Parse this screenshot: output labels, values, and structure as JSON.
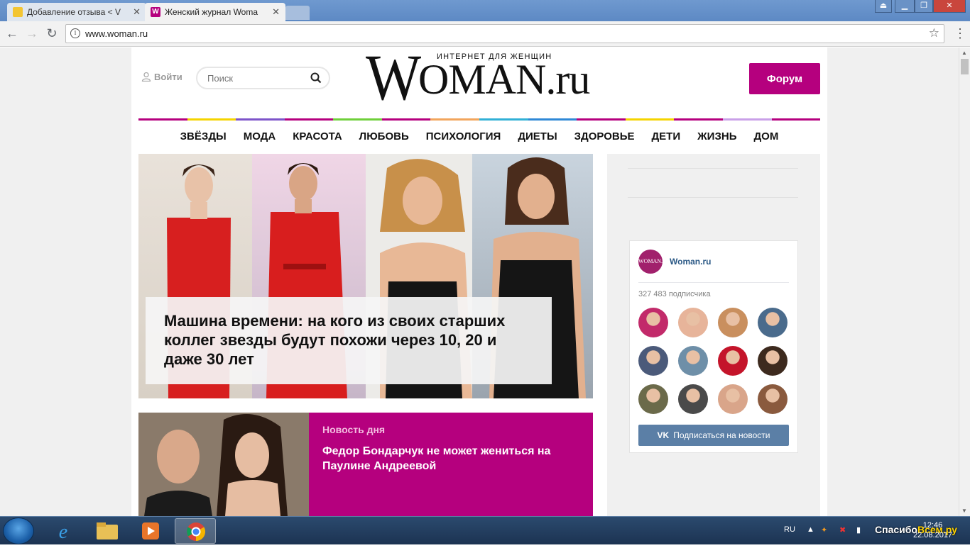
{
  "browser": {
    "tabs": [
      {
        "title": "Добавление отзыва < V",
        "active": false
      },
      {
        "title": "Женский журнал Woma",
        "active": true
      }
    ],
    "url": "www.woman.ru",
    "win_min": "▁",
    "win_max": "❐",
    "win_close": "✕",
    "win_extra": "⏏"
  },
  "header": {
    "login_label": "Войти",
    "search_placeholder": "Поиск",
    "logo_tagline": "ИНТЕРНЕТ ДЛЯ ЖЕНЩИН",
    "logo_w": "W",
    "logo_rest": "OMAN.ru",
    "forum_label": "Форум"
  },
  "colors": {
    "brand": "#b5007e",
    "line_segments": [
      "#b5007e",
      "#f5d400",
      "#7d54c9",
      "#b5007e",
      "#6fcf3a",
      "#b5007e",
      "#f2a55c",
      "#31b0d6",
      "#2f88d6",
      "#b5007e",
      "#f5d400",
      "#b5007e",
      "#c9a0e8",
      "#b5007e"
    ]
  },
  "nav": [
    "ЗВЁЗДЫ",
    "МОДА",
    "КРАСОТА",
    "ЛЮБОВЬ",
    "ПСИХОЛОГИЯ",
    "ДИЕТЫ",
    "ЗДОРОВЬЕ",
    "ДЕТИ",
    "ЖИЗНЬ",
    "ДОМ"
  ],
  "hero": {
    "title": "Машина времени: на кого из своих старших коллег звезды будут похожи через 10, 20 и даже 30 лет"
  },
  "news_of_day": {
    "label": "Новость дня",
    "title": "Федор Бондарчук не может жениться на Паулине Андреевой"
  },
  "vk_widget": {
    "avatar_text": "WOMAN.ru",
    "name": "Woman.ru",
    "subscribers": "327 483 подписчика",
    "subscribe_icon": "VK",
    "subscribe_label": "Подписаться на новости",
    "avatar_colors": [
      "#c22a6a",
      "#e7b49a",
      "#c98f5e",
      "#4a6b8c",
      "#4b5a7a",
      "#6e8fa8",
      "#c4142a",
      "#3d2a1e",
      "#6b6a4a",
      "#4a4a4a",
      "#d9a58a",
      "#8a5a3e"
    ]
  },
  "taskbar": {
    "lang": "RU",
    "time": "12:46",
    "date": "22.08.2017",
    "watermark_a": "Спасибо",
    "watermark_b": "Всем.ру"
  }
}
